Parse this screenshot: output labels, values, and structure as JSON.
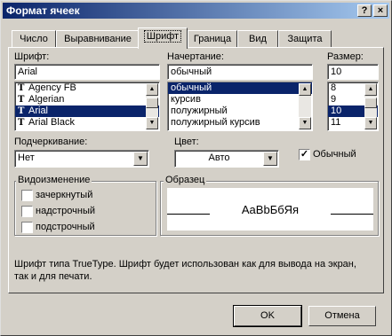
{
  "title": "Формат ячеек",
  "title_buttons": {
    "help": "?",
    "close": "×"
  },
  "tabs": [
    "Число",
    "Выравнивание",
    "Шрифт",
    "Граница",
    "Вид",
    "Защита"
  ],
  "font": {
    "label": "Шрифт:",
    "value": "Arial",
    "items": [
      "Agency FB",
      "Algerian",
      "Arial",
      "Arial Black"
    ],
    "selected": 2
  },
  "style": {
    "label": "Начертание:",
    "value": "обычный",
    "items": [
      "обычный",
      "курсив",
      "полужирный",
      "полужирный курсив"
    ],
    "selected": 0
  },
  "size": {
    "label": "Размер:",
    "value": "10",
    "items": [
      "8",
      "9",
      "10",
      "11"
    ],
    "selected": 2
  },
  "underline": {
    "label": "Подчеркивание:",
    "value": "Нет"
  },
  "color": {
    "label": "Цвет:",
    "value": "Авто"
  },
  "normal_font": {
    "label": "Обычный",
    "checked": true
  },
  "effects": {
    "label": "Видоизменение",
    "items": [
      "зачеркнутый",
      "надстрочный",
      "подстрочный"
    ]
  },
  "preview": {
    "label": "Образец",
    "text": "AaBbБбЯя"
  },
  "info_line1": "Шрифт типа TrueType. Шрифт будет использован как для вывода на экран,",
  "info_line2": "так и для печати.",
  "buttons": {
    "ok": "OK",
    "cancel": "Отмена"
  }
}
